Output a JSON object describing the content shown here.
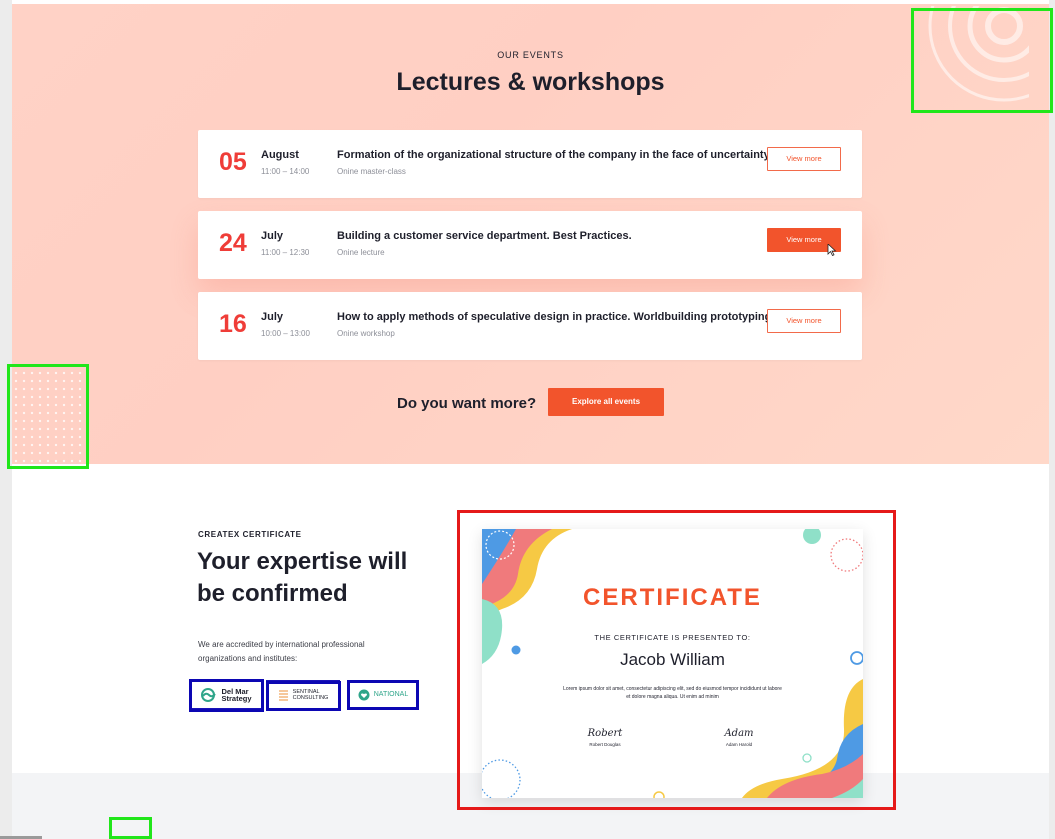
{
  "events_section": {
    "eyebrow": "OUR EVENTS",
    "title": "Lectures & workshops",
    "events": [
      {
        "day": "05",
        "month": "August",
        "time": "11:00 – 14:00",
        "title": "Formation of the organizational structure of the company in the face of uncertainty.",
        "type": "Onine master-class",
        "button": "View more"
      },
      {
        "day": "24",
        "month": "July",
        "time": "11:00 – 12:30",
        "title": "Building a customer service department. Best Practices.",
        "type": "Onine lecture",
        "button": "View more"
      },
      {
        "day": "16",
        "month": "July",
        "time": "10:00 – 13:00",
        "title": "How to apply methods of speculative design in practice. Worldbuilding prototyping.",
        "type": "Onine workshop",
        "button": "View more"
      }
    ],
    "more_text": "Do you want more?",
    "explore_button": "Explore all events"
  },
  "certificate_section": {
    "eyebrow": "CREATEX CERTIFICATE",
    "title": "Your expertise will be confirmed",
    "text": "We are accredited by international professional organizations and institutes:",
    "logos": [
      {
        "line1": "Del Mar",
        "line2": "Strategy",
        "icon": "del-mar-logo-icon"
      },
      {
        "line1": "SENTINAL",
        "line2": "CONSULTING",
        "icon": "sentinal-logo-icon"
      },
      {
        "line1": "NATIONAL",
        "line2": "",
        "icon": "national-logo-icon"
      }
    ]
  },
  "certificate_image": {
    "heading": "CERTIFICATE",
    "presented": "THE CERTIFICATE IS PRESENTED TO:",
    "name": "Jacob William",
    "body": "Lorem ipsum dolor sit amet, consectetur adipiscing elit, sed do eiusmod tempor incididunt ut labore et dolore magna aliqua. Ut enim ad minim",
    "signatures": [
      {
        "signature": "Robert",
        "name": "Robert Douglas"
      },
      {
        "signature": "Adam",
        "name": "Adam Harold"
      }
    ]
  },
  "colors": {
    "accent": "#f2542c",
    "day_red": "#ef3d38",
    "events_bg": "#ffd2c6",
    "annotation_green": "#21e61a",
    "annotation_blue": "#0c07b3",
    "annotation_red": "#e51919"
  }
}
